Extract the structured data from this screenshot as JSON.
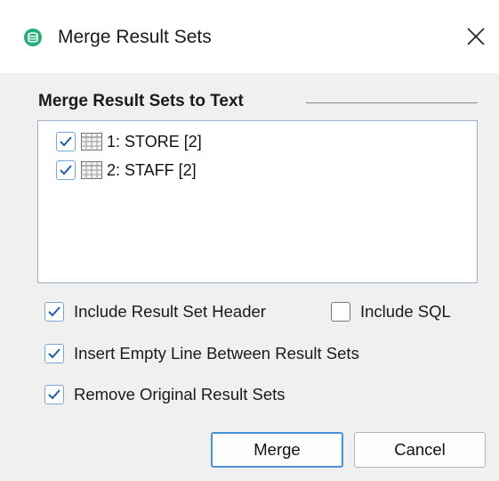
{
  "window": {
    "title": "Merge Result Sets",
    "app_icon": "database-icon",
    "close_icon": "close-icon"
  },
  "group": {
    "title": "Merge Result Sets to Text"
  },
  "result_sets": [
    {
      "label": "1: STORE [2]",
      "checked": true,
      "icon": "table-grid-icon"
    },
    {
      "label": "2: STAFF [2]",
      "checked": true,
      "icon": "table-grid-icon"
    }
  ],
  "options": {
    "include_header": {
      "label": "Include Result Set Header",
      "checked": true
    },
    "include_sql": {
      "label": "Include SQL",
      "checked": false
    },
    "insert_empty_line": {
      "label": "Insert Empty Line Between Result Sets",
      "checked": true
    },
    "remove_original": {
      "label": "Remove Original Result Sets",
      "checked": true
    }
  },
  "buttons": {
    "merge": "Merge",
    "cancel": "Cancel"
  },
  "colors": {
    "accent": "#4a90d9",
    "check": "#1f5fa8",
    "app_icon": "#27ae76"
  }
}
